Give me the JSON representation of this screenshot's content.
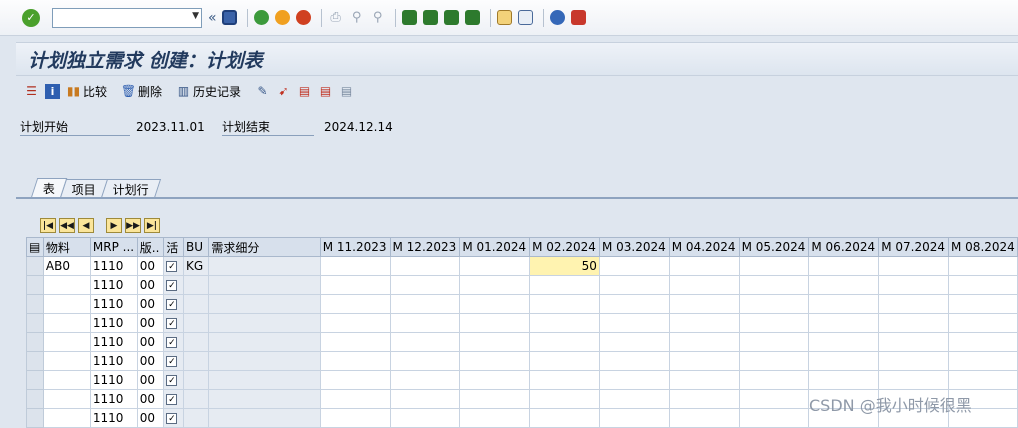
{
  "colors": {
    "accent": "#223a5e",
    "highlight_cell": "#fff3b0",
    "ok_green": "#4aa02c"
  },
  "topbar": {
    "command_value": "",
    "back_label": "«",
    "icons": [
      "save-icon",
      "back-icon",
      "exit-icon",
      "cancel-icon",
      "print-icon",
      "find-icon",
      "find-next-icon",
      "first-page-icon",
      "prev-page-icon",
      "next-page-icon",
      "last-page-icon",
      "new-session-icon",
      "shortcut-icon",
      "help-icon",
      "customize-icon"
    ]
  },
  "title": "计划独立需求 创建：计划表",
  "toolbar": {
    "compare_label": "比较",
    "delete_label": "删除",
    "history_label": "历史记录"
  },
  "fields": {
    "plan_start_label": "计划开始",
    "plan_start_value": "2023.11.01",
    "plan_end_label": "计划结束",
    "plan_end_value": "2024.12.14"
  },
  "tabs": [
    "表",
    "项目",
    "计划行"
  ],
  "grid": {
    "columns": [
      "物料",
      "MRP ...",
      "版..",
      "活",
      "BU",
      "需求细分",
      "M 11.2023",
      "M 12.2023",
      "M 01.2024",
      "M 02.2024",
      "M 03.2024",
      "M 04.2024",
      "M 05.2024",
      "M 06.2024",
      "M 07.2024",
      "M 08.2024"
    ],
    "rows": [
      {
        "material": "AB0",
        "mrp": "1110",
        "version": "00",
        "active": "✓",
        "bu": "KG",
        "req": "",
        "values": [
          "",
          "",
          "",
          "50",
          "",
          "",
          "",
          "",
          "",
          ""
        ]
      },
      {
        "material": "",
        "mrp": "1110",
        "version": "00",
        "active": "✓",
        "bu": "",
        "req": "",
        "values": [
          "",
          "",
          "",
          "",
          "",
          "",
          "",
          "",
          "",
          ""
        ]
      },
      {
        "material": "",
        "mrp": "1110",
        "version": "00",
        "active": "✓",
        "bu": "",
        "req": "",
        "values": [
          "",
          "",
          "",
          "",
          "",
          "",
          "",
          "",
          "",
          ""
        ]
      },
      {
        "material": "",
        "mrp": "1110",
        "version": "00",
        "active": "✓",
        "bu": "",
        "req": "",
        "values": [
          "",
          "",
          "",
          "",
          "",
          "",
          "",
          "",
          "",
          ""
        ]
      },
      {
        "material": "",
        "mrp": "1110",
        "version": "00",
        "active": "✓",
        "bu": "",
        "req": "",
        "values": [
          "",
          "",
          "",
          "",
          "",
          "",
          "",
          "",
          "",
          ""
        ]
      },
      {
        "material": "",
        "mrp": "1110",
        "version": "00",
        "active": "✓",
        "bu": "",
        "req": "",
        "values": [
          "",
          "",
          "",
          "",
          "",
          "",
          "",
          "",
          "",
          ""
        ]
      },
      {
        "material": "",
        "mrp": "1110",
        "version": "00",
        "active": "✓",
        "bu": "",
        "req": "",
        "values": [
          "",
          "",
          "",
          "",
          "",
          "",
          "",
          "",
          "",
          ""
        ]
      },
      {
        "material": "",
        "mrp": "1110",
        "version": "00",
        "active": "✓",
        "bu": "",
        "req": "",
        "values": [
          "",
          "",
          "",
          "",
          "",
          "",
          "",
          "",
          "",
          ""
        ]
      },
      {
        "material": "",
        "mrp": "1110",
        "version": "00",
        "active": "✓",
        "bu": "",
        "req": "",
        "values": [
          "",
          "",
          "",
          "",
          "",
          "",
          "",
          "",
          "",
          ""
        ]
      }
    ]
  },
  "watermark": "CSDN @我小时候很黑"
}
